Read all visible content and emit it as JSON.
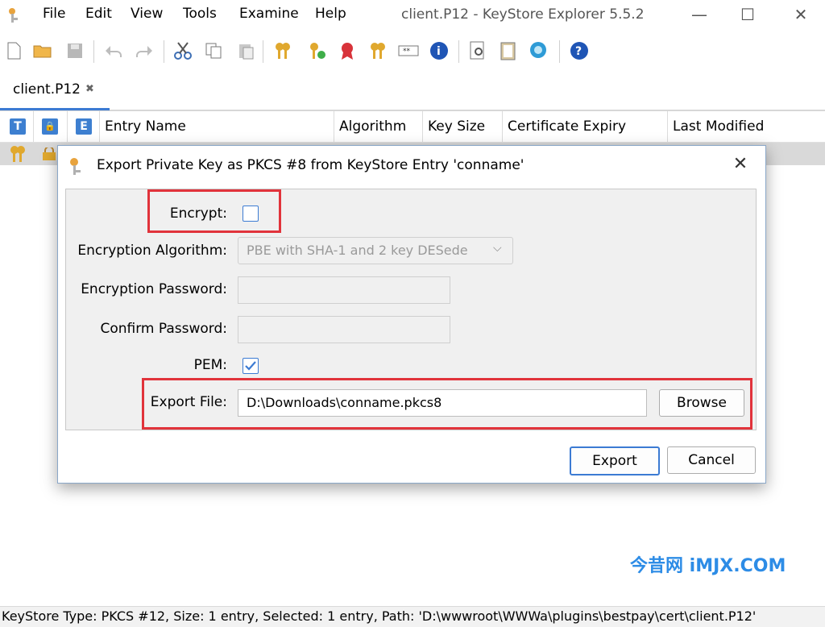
{
  "window": {
    "title": "client.P12 - KeyStore Explorer 5.5.2",
    "menu": [
      "File",
      "Edit",
      "View",
      "Tools",
      "Examine",
      "Help"
    ]
  },
  "toolbar": {
    "icons": [
      "new-icon",
      "open-icon",
      "save-icon",
      "undo-icon",
      "redo-icon",
      "cut-icon",
      "copy-icon",
      "paste-icon",
      "generate-keypair-icon",
      "generate-secret-key-icon",
      "import-trusted-cert-icon",
      "import-keypair-icon",
      "set-password-icon",
      "properties-icon",
      "examine-file-icon",
      "examine-clipboard-icon",
      "examine-ssl-icon",
      "help-icon"
    ]
  },
  "tab": {
    "label": "client.P12",
    "close": "✖"
  },
  "table": {
    "icon_headers": [
      "T",
      "🔒",
      "E"
    ],
    "columns": [
      "Entry Name",
      "Algorithm",
      "Key Size",
      "Certificate Expiry",
      "Last Modified"
    ]
  },
  "dialog": {
    "title": "Export Private Key as PKCS #8 from KeyStore Entry 'conname'",
    "encrypt_label": "Encrypt:",
    "encrypt_checked": false,
    "algorithm_label": "Encryption Algorithm:",
    "algorithm_value": "PBE with SHA-1 and 2 key DESede",
    "password_label": "Encryption Password:",
    "confirm_label": "Confirm Password:",
    "pem_label": "PEM:",
    "pem_checked": true,
    "export_file_label": "Export File:",
    "export_file_value": "D:\\Downloads\\conname.pkcs8",
    "browse_button": "Browse",
    "export_button": "Export",
    "cancel_button": "Cancel"
  },
  "status_bar": "KeyStore Type: PKCS #12, Size: 1 entry, Selected: 1 entry, Path: 'D:\\wwwroot\\WWWa\\plugins\\bestpay\\cert\\client.P12'",
  "watermark": "今昔网 iMJX.COM",
  "colors": {
    "accent": "#3c7bd3",
    "highlight": "#e1333b",
    "watermark": "#2d8ce6"
  }
}
